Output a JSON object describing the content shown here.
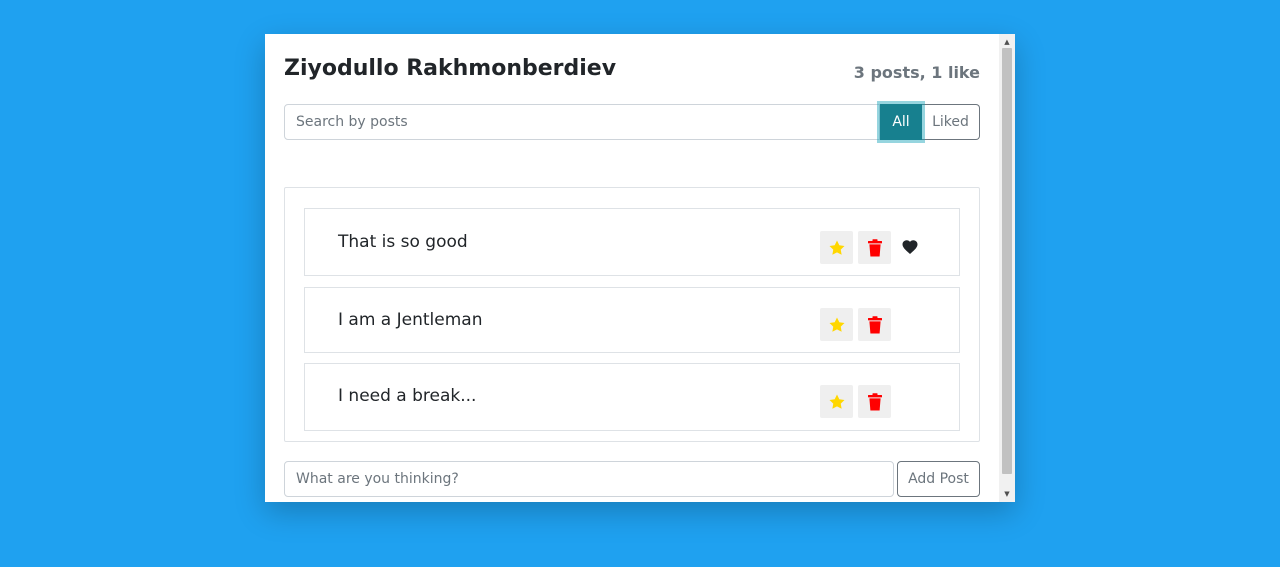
{
  "header": {
    "title": "Ziyodullo Rakhmonberdiev",
    "stats": "3 posts, 1 like"
  },
  "search": {
    "placeholder": "Search by posts",
    "value": ""
  },
  "filters": {
    "all_label": "All",
    "liked_label": "Liked",
    "active": "All"
  },
  "posts": [
    {
      "text": "That is so good",
      "liked": true
    },
    {
      "text": "I am a Jentleman",
      "liked": false
    },
    {
      "text": "I need a break...",
      "liked": false
    }
  ],
  "composer": {
    "placeholder": "What are you thinking?",
    "value": "",
    "button_label": "Add Post"
  },
  "icons": {
    "favorite": "star-icon",
    "delete": "trash-icon",
    "liked": "heart-icon",
    "scroll_up": "arrow-up-icon",
    "scroll_down": "arrow-down-icon"
  },
  "colors": {
    "background": "#1fa1f0",
    "accent": "#17808f",
    "star": "#ffd700",
    "trash": "#ff0000",
    "heart": "#212529",
    "muted": "#6c757d"
  }
}
